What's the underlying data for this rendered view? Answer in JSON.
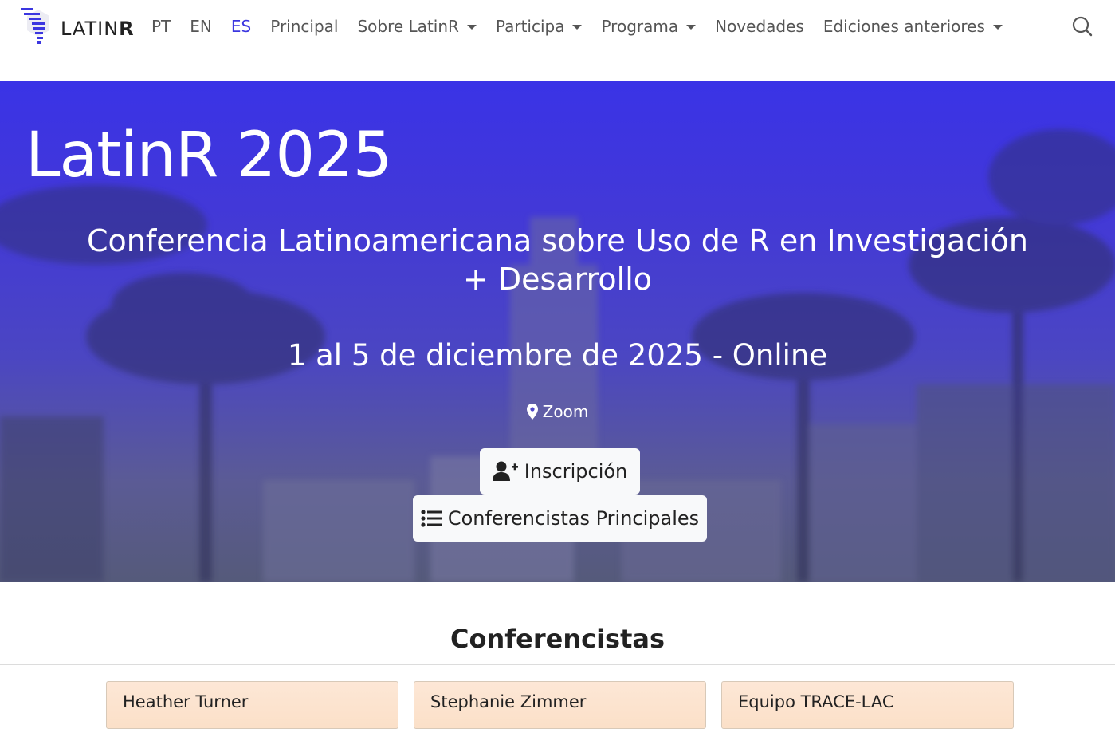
{
  "nav": {
    "logo_text_light": "LATIN",
    "logo_text_bold": "R",
    "languages": [
      "PT",
      "EN",
      "ES"
    ],
    "active_language": "ES",
    "items": [
      {
        "label": "Principal",
        "dropdown": false
      },
      {
        "label": "Sobre LatinR",
        "dropdown": true
      },
      {
        "label": "Participa",
        "dropdown": true
      },
      {
        "label": "Programa",
        "dropdown": true
      },
      {
        "label": "Novedades",
        "dropdown": false
      },
      {
        "label": "Ediciones anteriores",
        "dropdown": true
      }
    ],
    "search_icon": "search-icon"
  },
  "hero": {
    "title": "LatinR 2025",
    "subtitle": "Conferencia Latinoamericana sobre Uso de R en Investigación + Desarrollo",
    "date": "1 al 5 de diciembre de 2025 - Online",
    "location": "Zoom",
    "location_icon": "map-marker-icon",
    "buttons": [
      {
        "label": "Inscripción",
        "icon": "user-plus-icon"
      },
      {
        "label": "Conferencistas Principales",
        "icon": "list-icon"
      }
    ]
  },
  "speakers": {
    "title": "Conferencistas",
    "cards": [
      {
        "name": "Heather Turner"
      },
      {
        "name": "Stephanie Zimmer"
      },
      {
        "name": "Equipo TRACE-LAC"
      }
    ]
  },
  "colors": {
    "accent": "#3b36e0",
    "hero_top": "#3a33e6",
    "card_bg": "#fde7d6"
  }
}
